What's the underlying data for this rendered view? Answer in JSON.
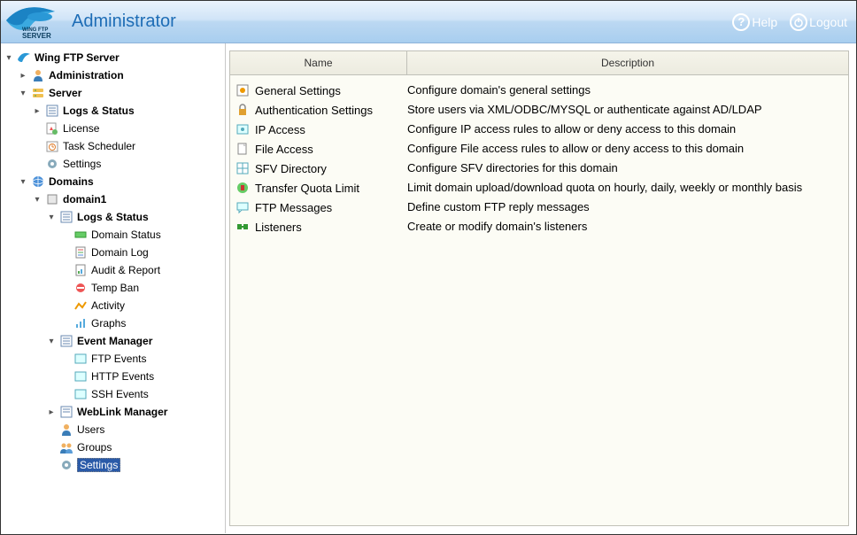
{
  "header": {
    "brand_line1": "WING FTP",
    "brand_line2": "SERVER",
    "title": "Administrator",
    "help": "Help",
    "logout": "Logout"
  },
  "tree": {
    "root": "Wing FTP Server",
    "administration": "Administration",
    "server": "Server",
    "server_children": {
      "logs_status": "Logs & Status",
      "license": "License",
      "task_scheduler": "Task Scheduler",
      "settings": "Settings"
    },
    "domains": "Domains",
    "domain1": "domain1",
    "domain1_children": {
      "logs_status": "Logs & Status",
      "ls_children": {
        "domain_status": "Domain Status",
        "domain_log": "Domain Log",
        "audit_report": "Audit & Report",
        "temp_ban": "Temp Ban",
        "activity": "Activity",
        "graphs": "Graphs"
      },
      "event_manager": "Event Manager",
      "em_children": {
        "ftp_events": "FTP Events",
        "http_events": "HTTP Events",
        "ssh_events": "SSH Events"
      },
      "weblink_manager": "WebLink Manager",
      "users": "Users",
      "groups": "Groups",
      "settings": "Settings"
    }
  },
  "grid": {
    "columns": {
      "name": "Name",
      "description": "Description"
    },
    "rows": [
      {
        "name": "General Settings",
        "desc": "Configure domain's general settings"
      },
      {
        "name": "Authentication Settings",
        "desc": "Store users via XML/ODBC/MYSQL or authenticate against AD/LDAP"
      },
      {
        "name": "IP Access",
        "desc": "Configure IP access rules to allow or deny access to this domain"
      },
      {
        "name": "File Access",
        "desc": "Configure File access rules to allow or deny access to this domain"
      },
      {
        "name": "SFV Directory",
        "desc": "Configure SFV directories for this domain"
      },
      {
        "name": "Transfer Quota Limit",
        "desc": "Limit domain upload/download quota on hourly, daily, weekly or monthly basis"
      },
      {
        "name": "FTP Messages",
        "desc": "Define custom FTP reply messages"
      },
      {
        "name": "Listeners",
        "desc": "Create or modify domain's listeners"
      }
    ]
  }
}
